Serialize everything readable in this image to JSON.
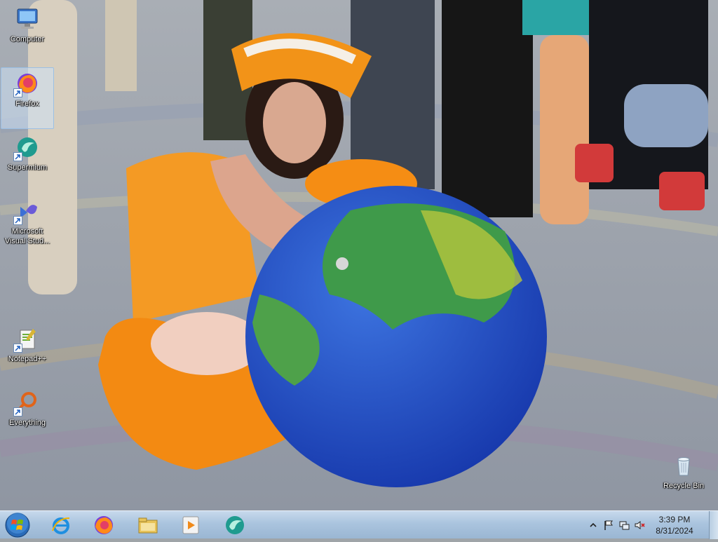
{
  "desktop": {
    "icons": [
      {
        "label": "Computer",
        "icon": "computer-icon"
      },
      {
        "label": "Firefox",
        "icon": "firefox-icon",
        "selected": true
      },
      {
        "label": "Supermium",
        "icon": "supermium-icon"
      },
      {
        "label": "Microsoft Visual Stud...",
        "icon": "visual-studio-icon"
      },
      {
        "label": "Notepad++",
        "icon": "notepadpp-icon"
      },
      {
        "label": "Everything",
        "icon": "everything-icon"
      },
      {
        "label": "Recycle Bin",
        "icon": "recycle-bin-icon"
      }
    ]
  },
  "taskbar": {
    "pinned": [
      "internet-explorer-icon",
      "firefox-icon",
      "file-explorer-icon",
      "media-player-icon",
      "supermium-icon"
    ],
    "tray": {
      "icons": [
        "show-hidden-icons-chevron",
        "action-center-flag-icon",
        "network-icon",
        "volume-muted-icon"
      ],
      "time": "3:39 PM",
      "date": "8/31/2024"
    }
  },
  "colors": {
    "taskbar_top": "#c7d9ec",
    "taskbar_bottom": "#9ab6d3",
    "fox_orange": "#f39a1c",
    "globe_blue": "#1c4fc4"
  }
}
